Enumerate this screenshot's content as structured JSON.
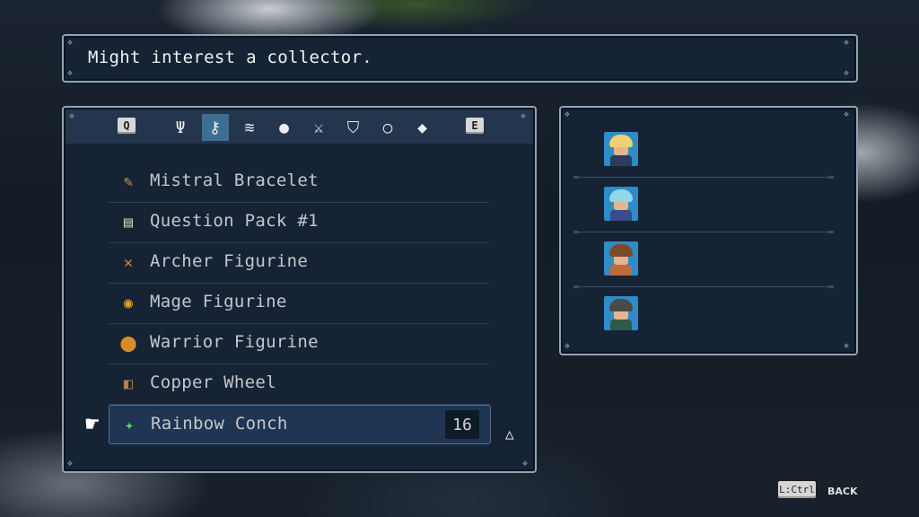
{
  "description": {
    "text": "Might interest a collector."
  },
  "tabs": {
    "prev_key": "Q",
    "next_key": "E",
    "items": [
      {
        "icon": "fork-icon",
        "glyph": "Ψ",
        "active": false
      },
      {
        "icon": "key-icon",
        "glyph": "⚷",
        "active": true
      },
      {
        "icon": "scroll-icon",
        "glyph": "≋",
        "active": false
      },
      {
        "icon": "food-icon",
        "glyph": "●",
        "active": false
      },
      {
        "icon": "sword-icon",
        "glyph": "⚔",
        "active": false
      },
      {
        "icon": "shield-icon",
        "glyph": "⛉",
        "active": false
      },
      {
        "icon": "ring-icon",
        "glyph": "○",
        "active": false
      },
      {
        "icon": "gem-icon",
        "glyph": "◆",
        "active": false
      }
    ]
  },
  "items": [
    {
      "name": "Mistral Bracelet",
      "icon": "bracelet-icon",
      "glyph": "✎",
      "color": "#c9a04a"
    },
    {
      "name": "Question Pack #1",
      "icon": "cards-icon",
      "glyph": "▤",
      "color": "#d8cdb0"
    },
    {
      "name": "Archer Figurine",
      "icon": "bow-figurine-icon",
      "glyph": "✕",
      "color": "#d88a2a"
    },
    {
      "name": "Mage Figurine",
      "icon": "mage-figurine-icon",
      "glyph": "◉",
      "color": "#e3a22b"
    },
    {
      "name": "Warrior Figurine",
      "icon": "warrior-figurine-icon",
      "glyph": "⬤",
      "color": "#d98c26"
    },
    {
      "name": "Copper Wheel",
      "icon": "copper-wheel-icon",
      "glyph": "◧",
      "color": "#b08058"
    },
    {
      "name": "Rainbow Conch",
      "icon": "conch-icon",
      "glyph": "✦",
      "color": "#5fd06a",
      "quantity": "16",
      "selected": true
    }
  ],
  "party": [
    {
      "name": "party-member-1",
      "hair": "#f0d070",
      "body": "#2c3c5c"
    },
    {
      "name": "party-member-2",
      "hair": "#8fd8e8",
      "body": "#3a4a8a"
    },
    {
      "name": "party-member-3",
      "hair": "#7a4a2a",
      "body": "#c06a3a"
    },
    {
      "name": "party-member-4",
      "hair": "#4a4a4a",
      "body": "#2e5a4a"
    }
  ],
  "footer": {
    "key": "L:Ctrl",
    "label": "BACK"
  },
  "colors": {
    "panel_bg": "#152335",
    "panel_border": "#8fa3b8",
    "active_tab": "#3d6f93",
    "selected_row": "#1f3552"
  }
}
